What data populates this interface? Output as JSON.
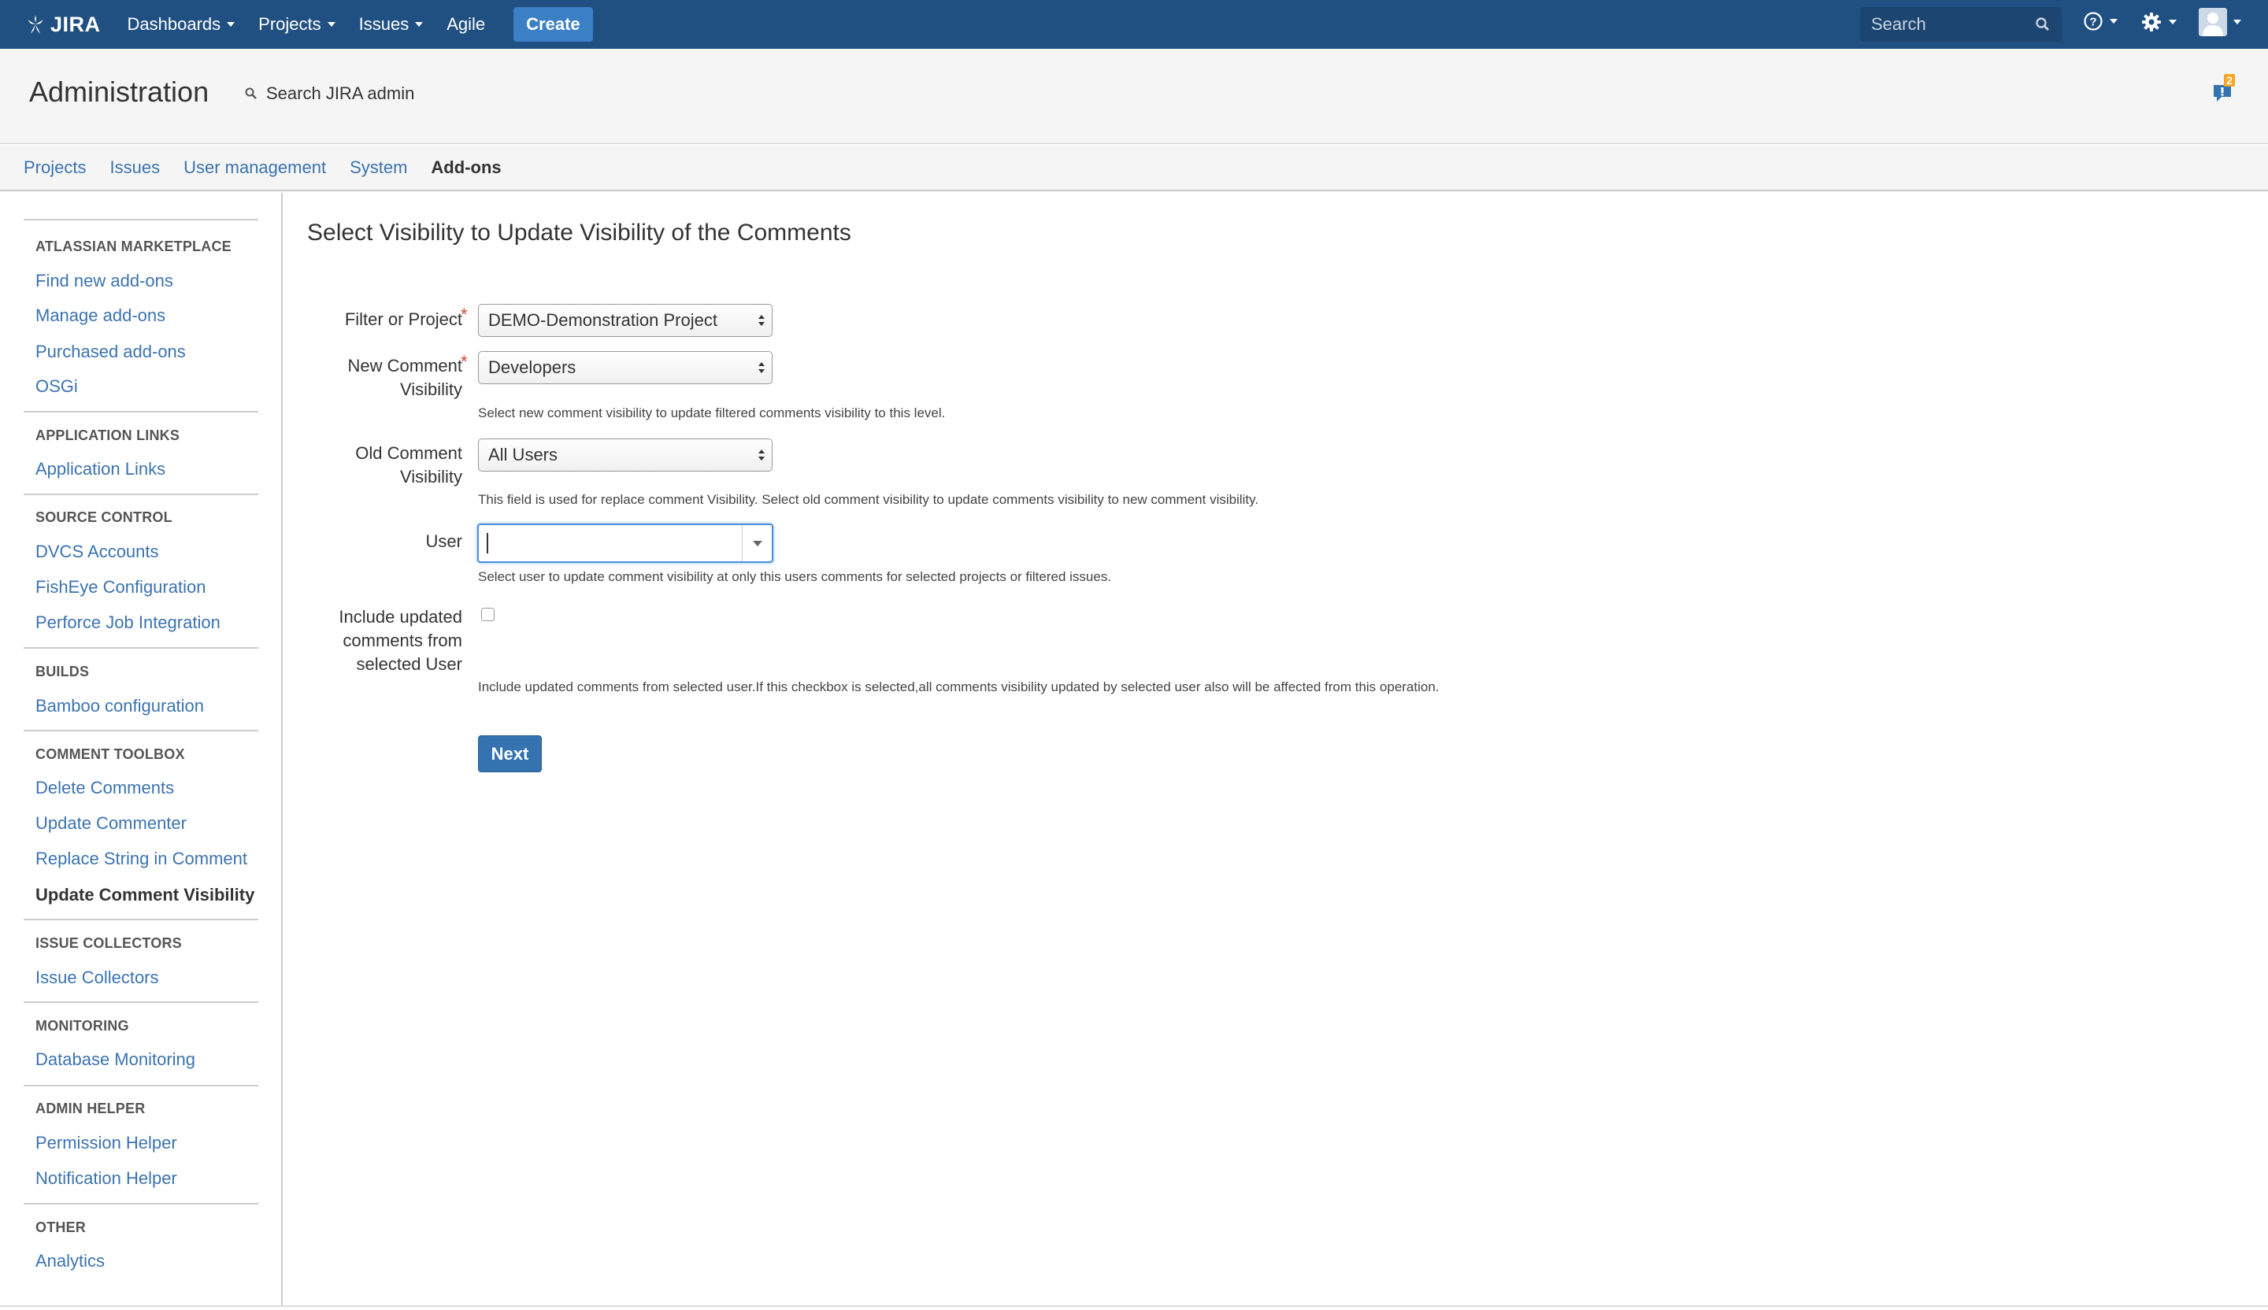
{
  "topnav": {
    "logo_text": "JIRA",
    "menus": [
      "Dashboards",
      "Projects",
      "Issues",
      "Agile"
    ],
    "create_label": "Create",
    "search_placeholder": "Search",
    "bg_color": "#205081"
  },
  "header": {
    "title": "Administration",
    "search_label": "Search JIRA admin",
    "notification_count": "2"
  },
  "tabs": [
    "Projects",
    "Issues",
    "User management",
    "System",
    "Add-ons"
  ],
  "sidebar": {
    "groups": [
      {
        "heading": "ATLASSIAN MARKETPLACE",
        "items": [
          "Find new add-ons",
          "Manage add-ons",
          "Purchased add-ons",
          "OSGi"
        ]
      },
      {
        "heading": "APPLICATION LINKS",
        "items": [
          "Application Links"
        ]
      },
      {
        "heading": "SOURCE CONTROL",
        "items": [
          "DVCS Accounts",
          "FishEye Configuration",
          "Perforce Job Integration"
        ]
      },
      {
        "heading": "BUILDS",
        "items": [
          "Bamboo configuration"
        ]
      },
      {
        "heading": "COMMENT TOOLBOX",
        "items": [
          "Delete Comments",
          "Update Commenter",
          "Replace String in Comment",
          "Update Comment Visibility"
        ]
      },
      {
        "heading": "ISSUE COLLECTORS",
        "items": [
          "Issue Collectors"
        ]
      },
      {
        "heading": "MONITORING",
        "items": [
          "Database Monitoring"
        ]
      },
      {
        "heading": "ADMIN HELPER",
        "items": [
          "Permission Helper",
          "Notification Helper"
        ]
      },
      {
        "heading": "OTHER",
        "items": [
          "Analytics"
        ]
      }
    ]
  },
  "form": {
    "title": "Select Visibility to Update Visibility of the Comments",
    "filter_label": "Filter or Project",
    "filter_value": "DEMO-Demonstration Project",
    "new_vis_label_1": "New Comment",
    "new_vis_label_2": "Visibility",
    "new_vis_value": "Developers",
    "new_vis_hint": "Select new comment visibility to update filtered comments visibility to this level.",
    "old_vis_label_1": "Old Comment",
    "old_vis_label_2": "Visibility",
    "old_vis_value": "All Users",
    "old_vis_hint": "This field is used for replace comment Visibility. Select old comment visibility to update comments visibility to new comment visibility.",
    "user_label": "User",
    "user_value": "",
    "user_hint": "Select user to update comment visibility at only this users comments for selected projects or filtered issues.",
    "include_label_1": "Include updated",
    "include_label_2": "comments from",
    "include_label_3": "selected User",
    "include_hint": "Include updated comments from selected user.If this checkbox is selected,all comments visibility updated by selected user also will be affected from this operation.",
    "next_label": "Next",
    "required_mark": "*"
  }
}
